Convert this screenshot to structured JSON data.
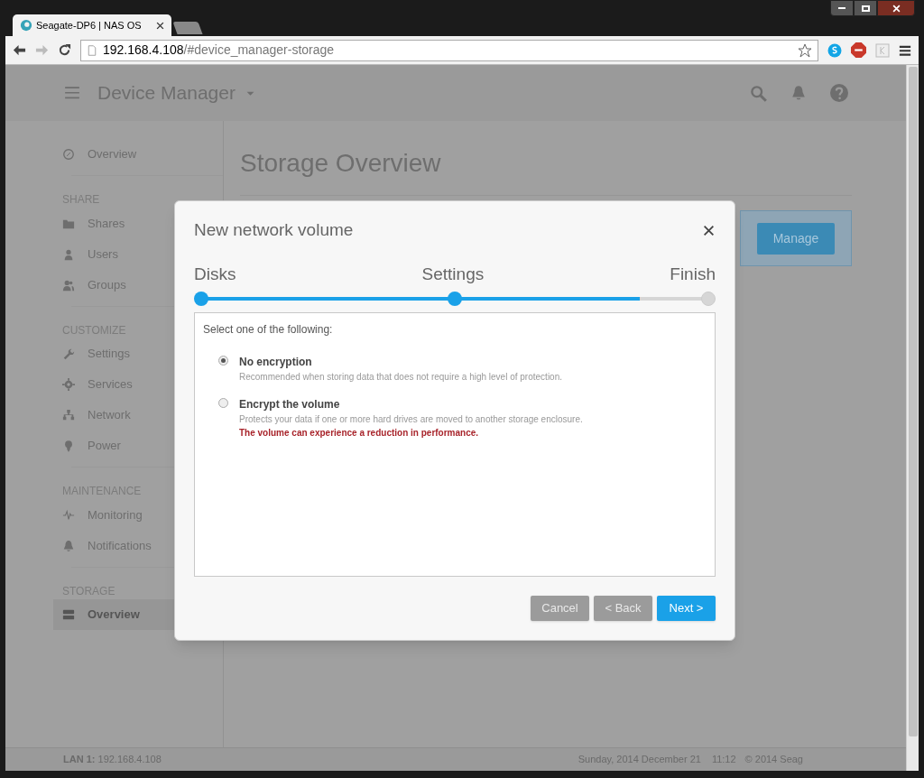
{
  "browser": {
    "tabs": [
      {
        "title": "Seagate-DP6 | NAS OS",
        "selected": true
      }
    ],
    "url": {
      "host": "192.168.4.108",
      "path": "/#device_manager-storage"
    }
  },
  "app_header": {
    "title": "Device Manager"
  },
  "sidebar": {
    "items": [
      {
        "kind": "item",
        "label": "Overview",
        "selected": false
      },
      {
        "kind": "heading",
        "label": "SHARE"
      },
      {
        "kind": "item",
        "label": "Shares",
        "selected": false
      },
      {
        "kind": "item",
        "label": "Users",
        "selected": false
      },
      {
        "kind": "item",
        "label": "Groups",
        "selected": false
      },
      {
        "kind": "heading",
        "label": "CUSTOMIZE"
      },
      {
        "kind": "item",
        "label": "Settings",
        "selected": false
      },
      {
        "kind": "item",
        "label": "Services",
        "selected": false
      },
      {
        "kind": "item",
        "label": "Network",
        "selected": false
      },
      {
        "kind": "item",
        "label": "Power",
        "selected": false
      },
      {
        "kind": "heading",
        "label": "MAINTENANCE"
      },
      {
        "kind": "item",
        "label": "Monitoring",
        "selected": false
      },
      {
        "kind": "item",
        "label": "Notifications",
        "selected": false
      },
      {
        "kind": "heading",
        "label": "STORAGE"
      },
      {
        "kind": "item",
        "label": "Overview",
        "selected": true
      }
    ]
  },
  "main": {
    "title": "Storage Overview",
    "manage_button": "Manage"
  },
  "dialog": {
    "title": "New network volume",
    "steps": [
      {
        "label": "Disks",
        "done": true
      },
      {
        "label": "Settings",
        "done": true
      },
      {
        "label": "Finish",
        "done": false
      }
    ],
    "progress": {
      "level": 0.865
    },
    "prompt": "Select one of the following:",
    "options": [
      {
        "title": "No encryption",
        "description": "Recommended when storing data that does not require a high level of protection.",
        "selected": true
      },
      {
        "title": "Encrypt the volume",
        "description": "Protects your data if one or more hard drives are moved to another storage enclosure.",
        "warning": "The volume can experience a reduction in performance.",
        "selected": false
      }
    ],
    "buttons": [
      {
        "label": "Cancel",
        "kind": "secondary"
      },
      {
        "label": "< Back",
        "kind": "secondary"
      },
      {
        "label": "Next >",
        "kind": "primary"
      }
    ]
  },
  "status_bar": {
    "lan": "**LAN 1:** 192.168.4.108",
    "date": "Sunday, 2014 December 21",
    "time": "11:12",
    "copyright": "© 2014 Seag"
  }
}
